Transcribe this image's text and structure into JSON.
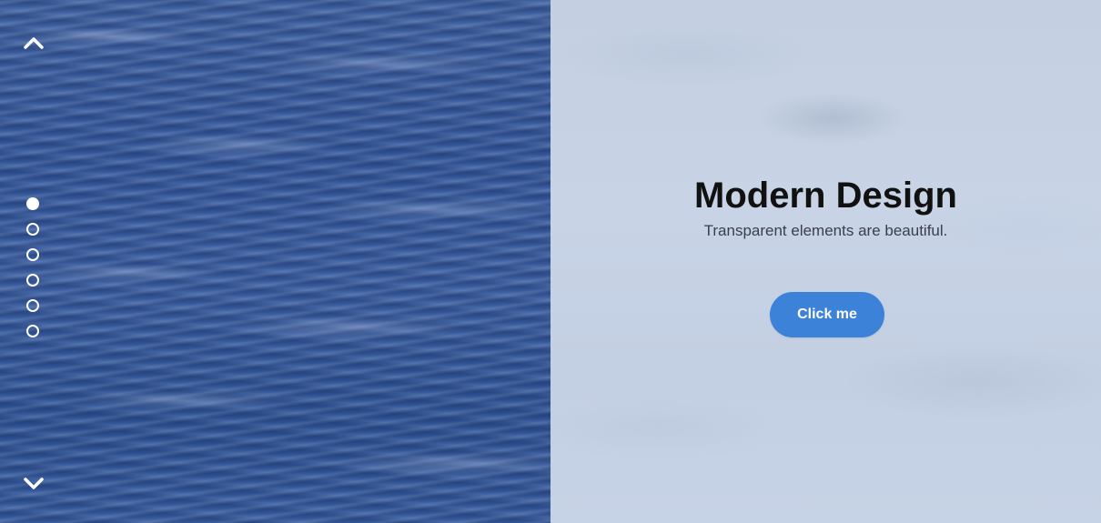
{
  "navigation": {
    "up_icon": "chevron-up-icon",
    "down_icon": "chevron-down-icon",
    "dots": [
      {
        "active": true
      },
      {
        "active": false
      },
      {
        "active": false
      },
      {
        "active": false
      },
      {
        "active": false
      },
      {
        "active": false
      }
    ]
  },
  "hero": {
    "title": "Modern Design",
    "subtitle": "Transparent elements are beautiful.",
    "button_label": "Click me"
  },
  "colors": {
    "accent": "#3b82d8",
    "title_text": "#111111",
    "subtitle_text": "#3a3f48",
    "water": "#34579a",
    "panel_tint": "#c6d2e5"
  }
}
